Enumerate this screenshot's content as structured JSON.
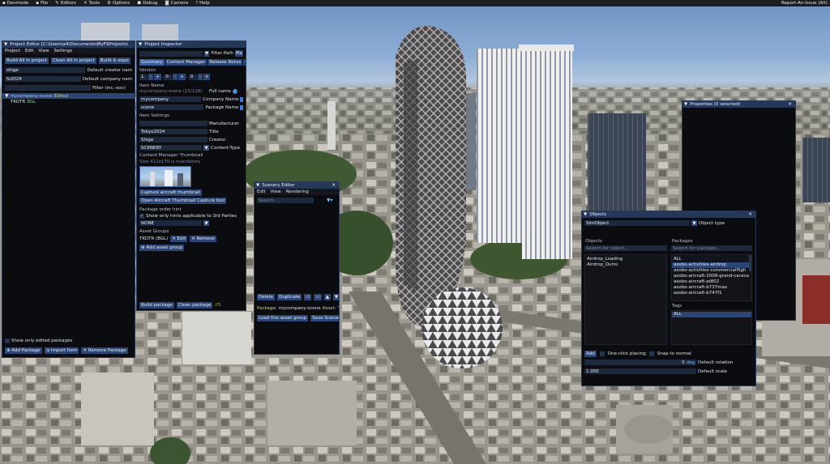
{
  "menubar": {
    "items": [
      "Devmode",
      "File",
      "Editors",
      "Tools",
      "Options",
      "Debug",
      "Camera",
      "Help"
    ],
    "report": "Report-An-Issue (Alt)"
  },
  "project_editor": {
    "title": "Project Editor [C:\\Users\\a4\\Documents\\MyFSProjects\\",
    "menu": [
      "Project",
      "Edit",
      "View",
      "Settings"
    ],
    "buttons": [
      "Build All in project",
      "Clean All in project",
      "Build & expo"
    ],
    "fields": [
      {
        "value": "shige",
        "label": "Default creator nam"
      },
      {
        "value": "fs2024",
        "label": "Default company nam"
      },
      {
        "value": "",
        "label": "Filter (inc,-exc)"
      }
    ],
    "tree_root": "mycompany-scene",
    "tree_root_status": "Edited",
    "tree_child": "TKOTR",
    "tree_child_tag": "BGL",
    "show_edited_label": "Show only edited packages",
    "bottom_buttons": [
      "Add Package",
      "Import Item",
      "Remove Package"
    ]
  },
  "project_inspector": {
    "title": "Project Inspector",
    "filter_label": "Filter Path",
    "filter_extra": "Me",
    "tabs": [
      "Summary",
      "Content Manager",
      "Release Notes",
      "Gl"
    ],
    "version_label": "Version",
    "version": [
      "1",
      "0",
      "0"
    ],
    "item_name_label": "Item Name",
    "item_name": "mycompany-scene (15/128)",
    "full_name_label": "Full name",
    "company_value": "mycompany",
    "company_label": "Company Name",
    "package_value": "scene",
    "package_label": "Package Name",
    "item_settings_label": "Item Settings",
    "settings": [
      {
        "value": "",
        "label": "Manufacturer"
      },
      {
        "value": "Tokyo2024",
        "label": "Title"
      },
      {
        "value": "Shige",
        "label": "Creator"
      },
      {
        "value": "SCENERY",
        "label": "Content-Type"
      }
    ],
    "thumb_header": "Content Manager Thumbnail",
    "thumb_size": "Size 412x170 is mandatory",
    "capture_btn": "Capture aircraft thumbnail",
    "open_capture_btn": "Open Aircraft Thumbnail Capture tool",
    "order_hint_label": "Package order hint",
    "show_hints_label": "Show only hints applicable to 3rd Parties",
    "order_hint_value": "NONE",
    "asset_groups_label": "Asset Groups",
    "asset_group_name": "TKOTR (BGL)",
    "edit_btn": "Edit",
    "remove_btn": "Remove",
    "add_group_btn": "Add asset group",
    "build_pkg_btn": "Build package",
    "clean_pkg_btn": "Clean package",
    "note": "(?)"
  },
  "scenery_editor": {
    "title": "Scenery Editor",
    "menu": [
      "Edit",
      "View",
      "Rendering"
    ],
    "search_placeholder": "Search ...",
    "delete_btn": "Delete",
    "duplicate_btn": "Duplicate",
    "package_label": "Package:",
    "package_value": "mycompany-scene",
    "asset_label": "Asset:",
    "asset_value": "TK",
    "load_btn": "Load this asset group",
    "save_btn": "Save Scenery"
  },
  "properties": {
    "title": "Properties (0 selected)"
  },
  "objects": {
    "title": "Objects",
    "type_value": "SimObject",
    "type_label": "Object type",
    "objects_label": "Objects",
    "packages_label": "Packages",
    "search_objects_placeholder": "Search for object...",
    "search_packages_placeholder": "Search for package...",
    "object_items": [
      "Airdrop_Loading",
      "Airdrop_Outro"
    ],
    "package_items": [
      "ALL",
      "asobo-activities-airdrop",
      "asobo-activities-commercialfligh",
      "asobo-aircraft-2008-grand-carava",
      "asobo-aircraft-at802",
      "asobo-aircraft-b737max",
      "asobo-aircraft-b747f1"
    ],
    "package_selected_index": 1,
    "tags_label": "Tags",
    "tag_items": [
      "ALL"
    ],
    "add_btn": "Add",
    "one_click_label": "One-click placing",
    "snap_label": "Snap to normal",
    "rotation_value": "0",
    "rotation_unit": "deg",
    "rotation_label": "Default rotation",
    "scale_value": "1.000",
    "scale_label": "Default scale"
  },
  "colors": {
    "accent": "#2b4674",
    "title_bar": "#26385a",
    "panel_bg": "#0b0c10",
    "edited": "#e0d36a",
    "highlight_tree": "#2b4674"
  }
}
